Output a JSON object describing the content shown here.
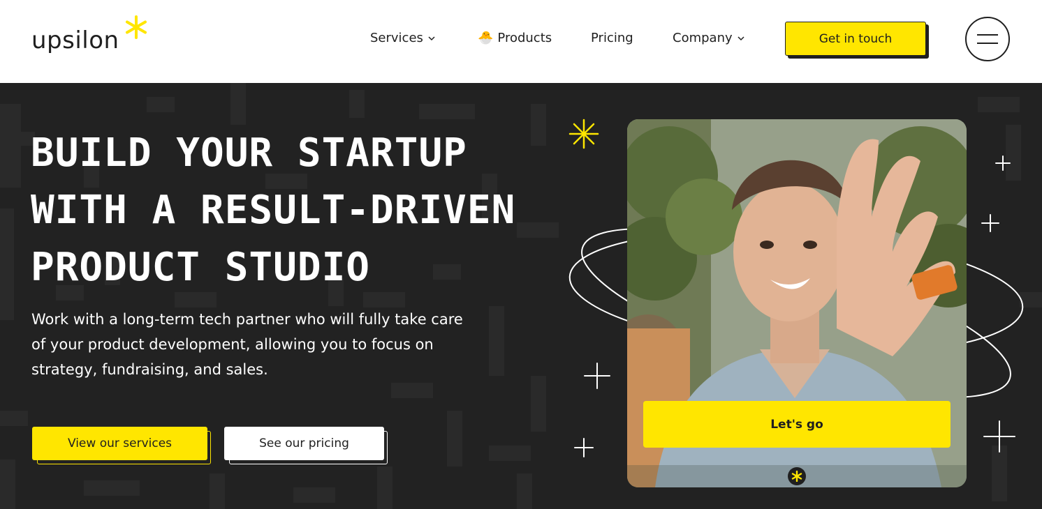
{
  "brand": {
    "logo_text": "upsilon",
    "accent_color": "#ffe600",
    "dark_color": "#222222"
  },
  "nav": {
    "items": [
      {
        "label": "Services",
        "icon": "chevron-down-icon"
      },
      {
        "label": "Products",
        "icon": "hand-emoji-icon",
        "emoji": "🐣"
      },
      {
        "label": "Pricing"
      },
      {
        "label": "Company",
        "icon": "chevron-down-icon"
      }
    ],
    "cta_label": "Get in touch",
    "menu_icon": "hamburger-menu-icon"
  },
  "hero": {
    "headline": [
      "BUILD YOUR STARTUP",
      "WITH A RESULT-DRIVEN",
      "PRODUCT STUDIO"
    ],
    "subtext": "Work with a long-term tech partner who will fully take care of your product development, allowing you to focus on strategy, fundraising, and sales.",
    "primary_button": "View our services",
    "secondary_button": "See our pricing"
  },
  "video_card": {
    "button_label": "Let's go",
    "badge_icon": "asterisk-icon"
  }
}
